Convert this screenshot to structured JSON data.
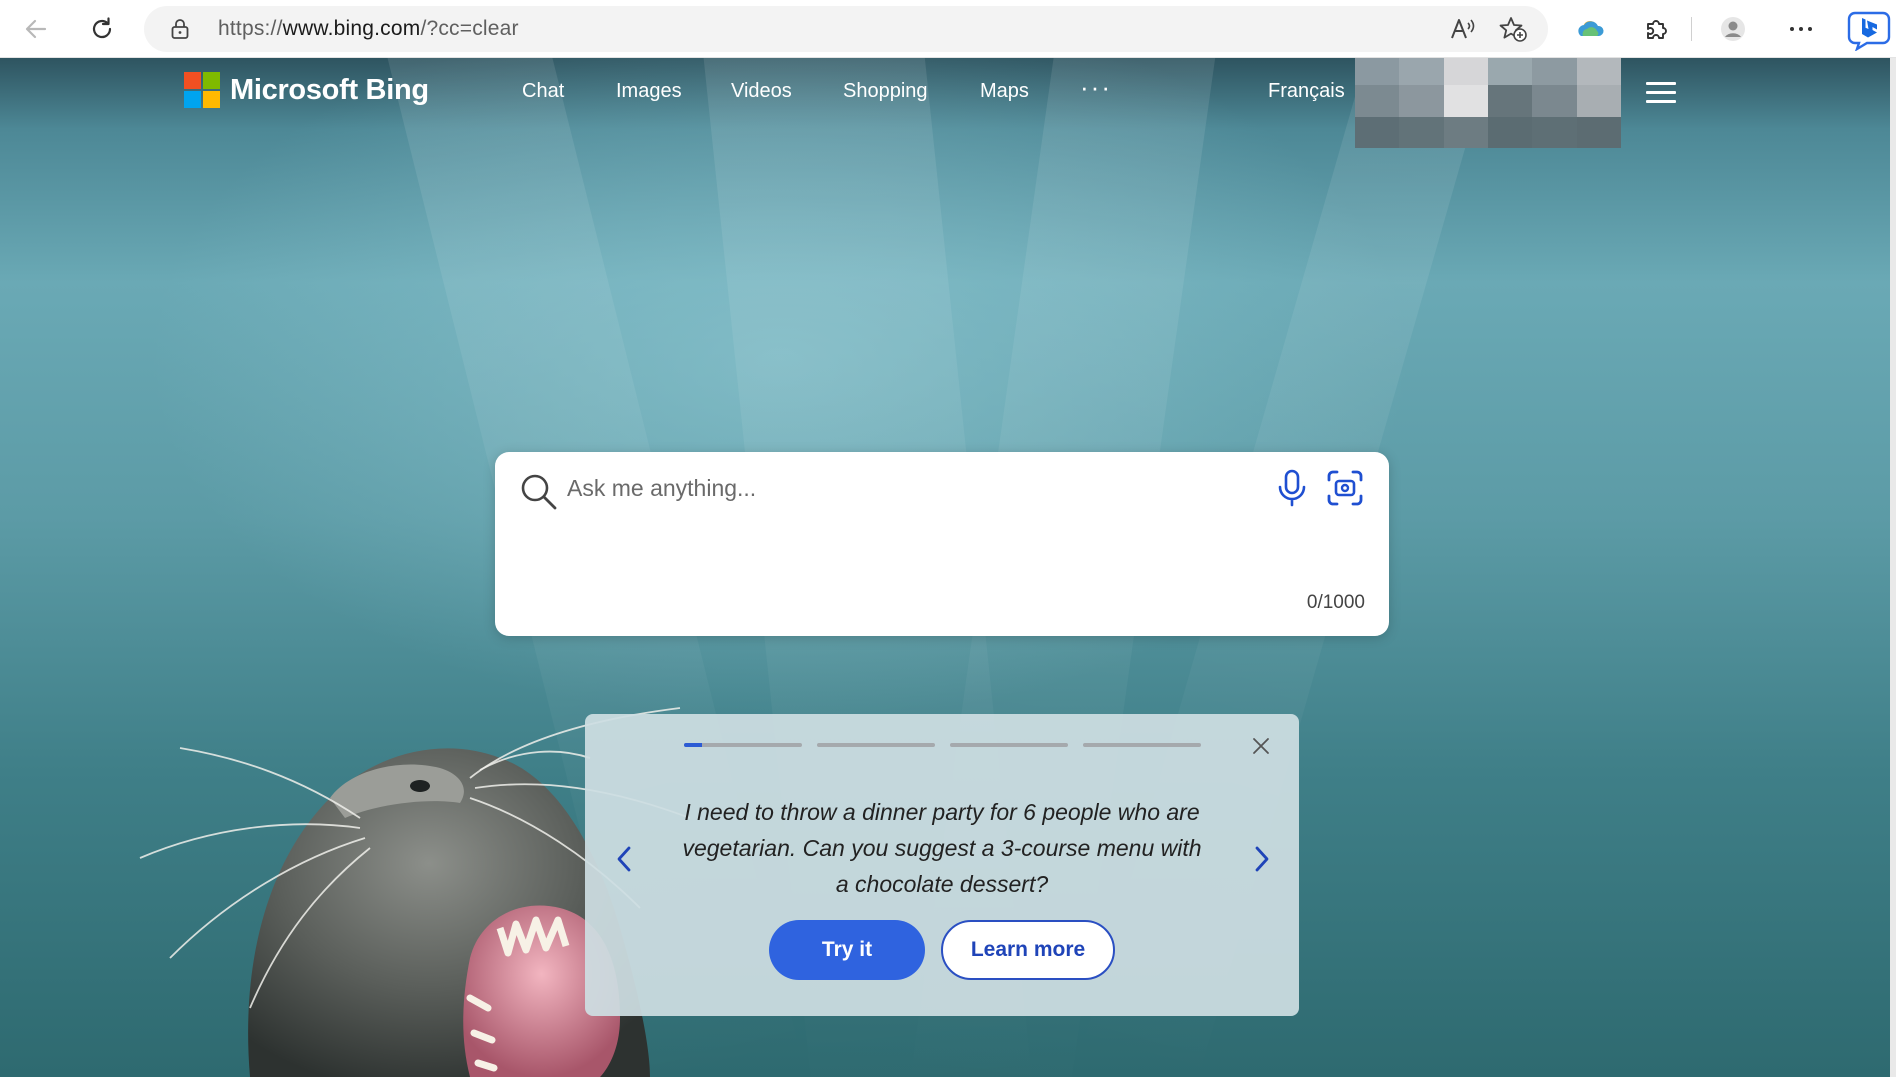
{
  "browser": {
    "url_prefix": "https://",
    "url_host": "www.bing.com",
    "url_path": "/?cc=clear"
  },
  "nav": {
    "brand": "Microsoft Bing",
    "items": [
      {
        "label": "Chat"
      },
      {
        "label": "Images"
      },
      {
        "label": "Videos"
      },
      {
        "label": "Shopping"
      },
      {
        "label": "Maps"
      }
    ],
    "more": "···",
    "language": "Français"
  },
  "search": {
    "placeholder": "Ask me anything...",
    "counter": "0/1000"
  },
  "suggestion": {
    "text": "I need to throw a dinner party for 6 people who are vegetarian. Can you suggest a 3-course menu with a chocolate dessert?",
    "try_label": "Try it",
    "learn_label": "Learn more",
    "active_progress_fraction": 0.15
  },
  "colors": {
    "accent": "#2f63df",
    "logo_red": "#f25022",
    "logo_green": "#7fba00",
    "logo_blue": "#00a4ef",
    "logo_yellow": "#ffb900"
  }
}
